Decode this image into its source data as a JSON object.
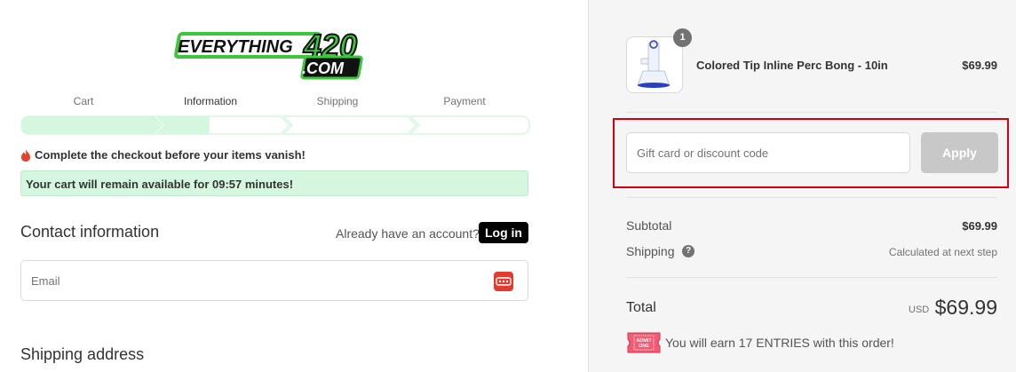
{
  "logo": {
    "line1": "EVERYTHING",
    "number": "420",
    "tld": ".COM"
  },
  "steps": [
    {
      "label": "Cart"
    },
    {
      "label": "Information"
    },
    {
      "label": "Shipping"
    },
    {
      "label": "Payment"
    }
  ],
  "timer": {
    "warning": "Complete the checkout before your items vanish!",
    "banner": "Your cart will remain available for 09:57 minutes!"
  },
  "contact": {
    "title": "Contact information",
    "account_prompt": "Already have an account?",
    "login_label": "Log in",
    "email_placeholder": "Email"
  },
  "shipping": {
    "title": "Shipping address"
  },
  "order": {
    "quantity": "1",
    "product_name": "Colored Tip Inline Perc Bong - 10in",
    "product_price": "$69.99"
  },
  "discount": {
    "placeholder": "Gift card or discount code",
    "apply_label": "Apply"
  },
  "summary": {
    "subtotal_label": "Subtotal",
    "subtotal_value": "$69.99",
    "shipping_label": "Shipping",
    "shipping_value": "Calculated at next step",
    "help_glyph": "?",
    "total_label": "Total",
    "currency": "USD",
    "total_value": "$69.99"
  },
  "rewards": {
    "ticket_line1": "ADMIT",
    "ticket_line2": "ONE",
    "text": "You will earn  17  ENTRIES with this order!"
  },
  "colors": {
    "brand_green": "#3cc63c",
    "highlight": "#d9000d",
    "banner_bg": "#d5f7df"
  }
}
